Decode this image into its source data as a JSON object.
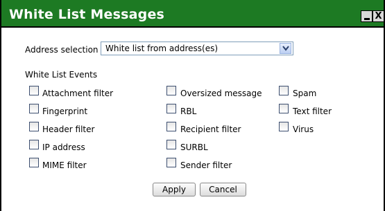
{
  "window": {
    "title": "White List Messages",
    "minimize_label": "_",
    "close_label": "X"
  },
  "address": {
    "label": "Address selection",
    "selected": "White list from address(es)"
  },
  "events": {
    "heading": "White List Events",
    "items": [
      {
        "label": "Attachment filter",
        "checked": false
      },
      {
        "label": "Fingerprint",
        "checked": false
      },
      {
        "label": "Header filter",
        "checked": false
      },
      {
        "label": "IP address",
        "checked": false
      },
      {
        "label": "MIME filter",
        "checked": false
      },
      {
        "label": "Oversized message",
        "checked": false
      },
      {
        "label": "RBL",
        "checked": false
      },
      {
        "label": "Recipient filter",
        "checked": false
      },
      {
        "label": "SURBL",
        "checked": false
      },
      {
        "label": "Sender filter",
        "checked": false
      },
      {
        "label": "Spam",
        "checked": false
      },
      {
        "label": "Text filter",
        "checked": false
      },
      {
        "label": "Virus",
        "checked": false
      }
    ]
  },
  "buttons": {
    "apply": "Apply",
    "cancel": "Cancel"
  },
  "colors": {
    "titlebar": "#1d7a23"
  }
}
